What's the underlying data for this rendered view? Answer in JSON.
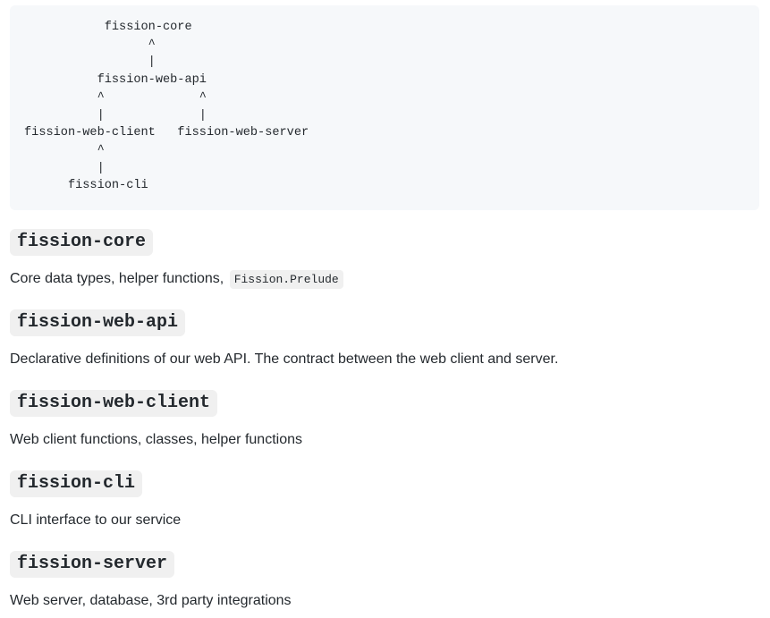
{
  "diagram": {
    "lines": [
      "           fission-core",
      "                 ^",
      "                 |",
      "          fission-web-api",
      "          ^             ^",
      "          |             |",
      "fission-web-client   fission-web-server",
      "          ^",
      "          |",
      "      fission-cli"
    ]
  },
  "sections": [
    {
      "heading": "fission-core",
      "description": "Core data types, helper functions,",
      "inline_code": "Fission.Prelude"
    },
    {
      "heading": "fission-web-api",
      "description": "Declarative definitions of our web API. The contract between the web client and server."
    },
    {
      "heading": "fission-web-client",
      "description": "Web client functions, classes, helper functions"
    },
    {
      "heading": "fission-cli",
      "description": "CLI interface to our service"
    },
    {
      "heading": "fission-server",
      "description": "Web server, database, 3rd party integrations"
    }
  ]
}
